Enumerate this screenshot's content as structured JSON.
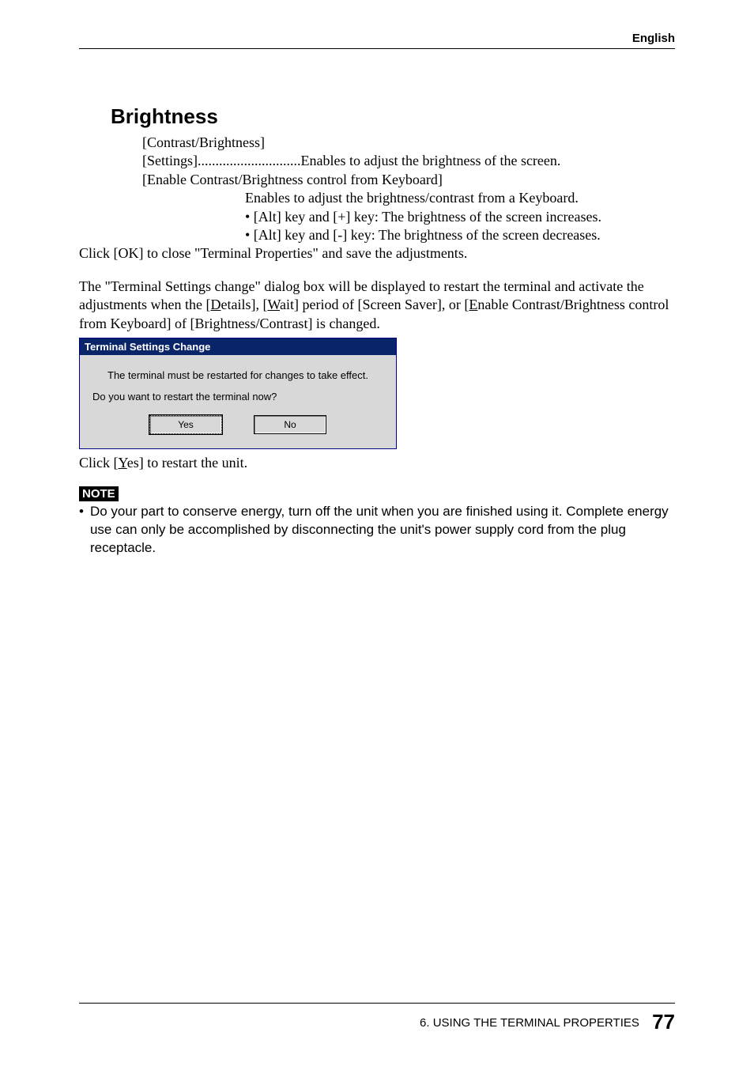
{
  "header": {
    "language": "English"
  },
  "section": {
    "title": "Brightness"
  },
  "content": {
    "contrast_label": "[Contrast/Brightness]",
    "settings_line": "[Settings].............................Enables to adjust the brightness of the screen.",
    "enable_line": "[Enable Contrast/Brightness control from Keyboard]",
    "desc1": "Enables to adjust the brightness/contrast from a Keyboard.",
    "bullet1": "• [Alt] key and [+] key:  The brightness of the screen increases.",
    "bullet2": "• [Alt] key and [-] key:  The brightness of the screen decreases.",
    "click_ok": "Click [OK] to close \"Terminal Properties\" and save the adjustments.",
    "para2a": "The \"Terminal Settings change\" dialog box will be displayed to restart the terminal and activate the adjustments when the [",
    "para2b": "etails], [",
    "para2c": "ait] period of [Screen Saver], or [",
    "para2d": "nable Contrast/Brightness control from Keyboard] of [Brightness/Contrast] is changed.",
    "underD": "D",
    "underW": "W",
    "underE": "E",
    "click_yes_a": "Click [",
    "click_yes_b": "es] to restart the unit.",
    "underY": "Y"
  },
  "dialog": {
    "title": "Terminal Settings Change",
    "line1": "The terminal must be restarted for changes to take effect.",
    "line2": "Do you want to restart the terminal now?",
    "yes": "Yes",
    "no": "No"
  },
  "note": {
    "label": "NOTE",
    "item1": "Do your part to conserve energy, turn off the unit when you are finished using it. Complete energy use can only be accomplished by disconnecting the unit's power supply cord from the plug receptacle."
  },
  "footer": {
    "chapter": "6. USING THE TERMINAL PROPERTIES",
    "page": "77"
  }
}
